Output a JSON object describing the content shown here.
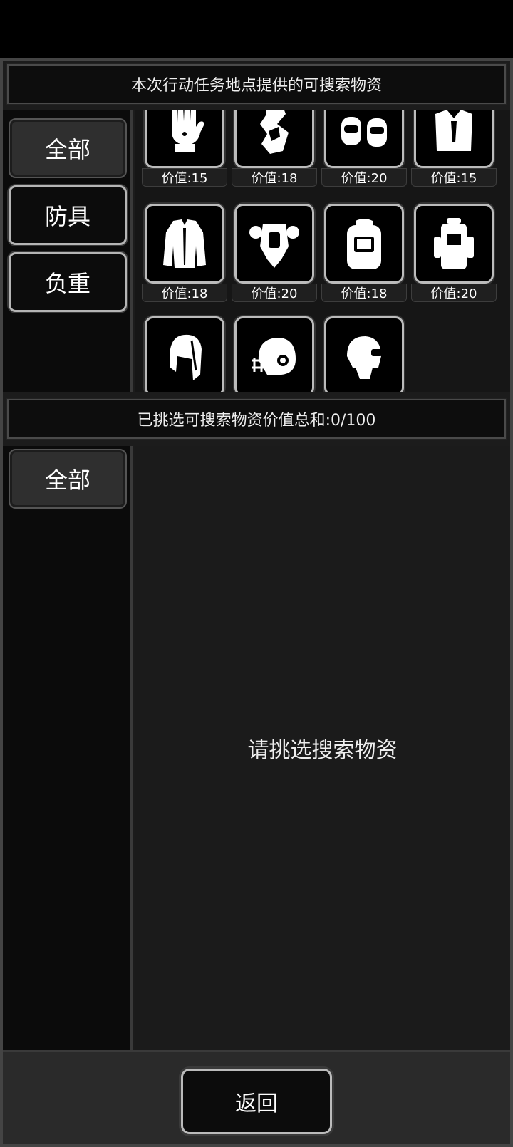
{
  "top_title": "本次行动任务地点提供的可搜索物资",
  "top_categories": [
    {
      "label": "全部",
      "active": true
    },
    {
      "label": "防具",
      "active": false
    },
    {
      "label": "负重",
      "active": false
    }
  ],
  "items": [
    {
      "icon": "gloves-icon",
      "qty": "1",
      "value": "价值:15"
    },
    {
      "icon": "fur-wrap-icon",
      "qty": "1",
      "value": "价值:18"
    },
    {
      "icon": "knee-pads-icon",
      "qty": "1",
      "value": "价值:20"
    },
    {
      "icon": "fur-vest-icon",
      "qty": "1",
      "value": "价值:15"
    },
    {
      "icon": "fur-coat-icon",
      "qty": "1",
      "value": "价值:18"
    },
    {
      "icon": "body-armor-icon",
      "qty": "1",
      "value": "价值:20"
    },
    {
      "icon": "backpack-icon",
      "qty": "1",
      "value": "价值:18"
    },
    {
      "icon": "hiking-backpack-icon",
      "qty": "1",
      "value": "价值:20"
    },
    {
      "icon": "aviator-cap-icon",
      "qty": "1",
      "value": ""
    },
    {
      "icon": "football-helmet-icon",
      "qty": "1",
      "value": ""
    },
    {
      "icon": "visor-helmet-icon",
      "qty": "1",
      "value": ""
    }
  ],
  "selected_title": "已挑选可搜索物资价值总和:0/100",
  "bottom_categories": [
    {
      "label": "全部",
      "active": true
    }
  ],
  "empty_message": "请挑选搜索物资",
  "back_label": "返回"
}
